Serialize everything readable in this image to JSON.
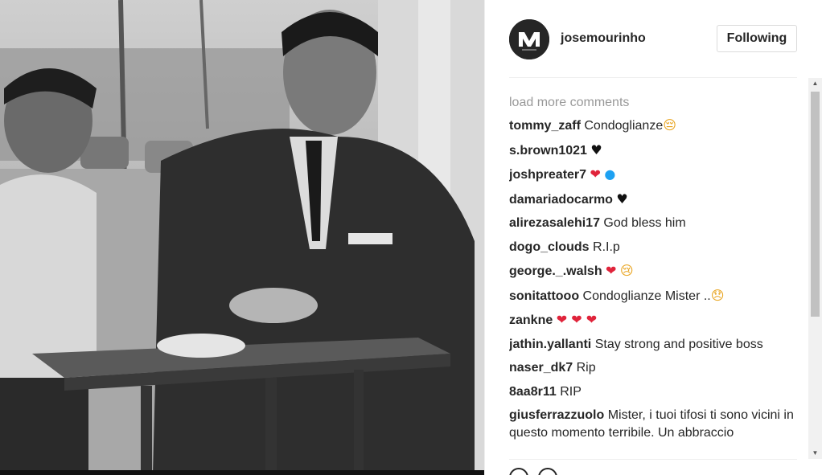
{
  "post": {
    "username": "josemourinho",
    "follow_label": "Following",
    "load_more": "load more comments"
  },
  "comments": [
    {
      "user": "tommy_zaff",
      "text": "Condoglianze",
      "emoji": "😔",
      "emoji_names": [
        "sad-face-icon"
      ]
    },
    {
      "user": "s.brown1021",
      "text": "",
      "emoji": "♥",
      "emoji_names": [
        "black-heart-icon"
      ]
    },
    {
      "user": "joshpreater7",
      "text": "",
      "emoji": "❤ ●",
      "emoji_names": [
        "red-heart-icon",
        "blue-circle-icon"
      ]
    },
    {
      "user": "damariadocarmo",
      "text": "",
      "emoji": "♥",
      "emoji_names": [
        "black-heart-icon"
      ]
    },
    {
      "user": "alirezasalehi17",
      "text": "God bless him",
      "emoji": "",
      "emoji_names": []
    },
    {
      "user": "dogo_clouds",
      "text": "R.I.p",
      "emoji": "",
      "emoji_names": []
    },
    {
      "user": "george._.walsh",
      "text": "",
      "emoji": "❤ 😢",
      "emoji_names": [
        "red-heart-icon",
        "crying-face-icon"
      ]
    },
    {
      "user": "sonitattooo",
      "text": "Condoglianze Mister ..",
      "emoji": "😞",
      "emoji_names": [
        "disappointed-face-icon"
      ]
    },
    {
      "user": "zankne",
      "text": "",
      "emoji": "❤ ❤ ❤",
      "emoji_names": [
        "red-heart-icon",
        "red-heart-icon",
        "red-heart-icon"
      ]
    },
    {
      "user": "jathin.yallanti",
      "text": "Stay strong and positive boss",
      "emoji": "",
      "emoji_names": []
    },
    {
      "user": "naser_dk7",
      "text": "Rip",
      "emoji": "",
      "emoji_names": []
    },
    {
      "user": "8aa8r11",
      "text": "RIP",
      "emoji": "",
      "emoji_names": []
    },
    {
      "user": "giusferrazzuolo",
      "text": "Mister, i tuoi tifosi ti sono vicini in questo momento terribile. Un abbraccio",
      "emoji": "",
      "emoji_names": []
    }
  ],
  "colors": {
    "text": "#262626",
    "muted": "#999999",
    "heart": "#e0243b",
    "border": "#dbdbdb"
  }
}
